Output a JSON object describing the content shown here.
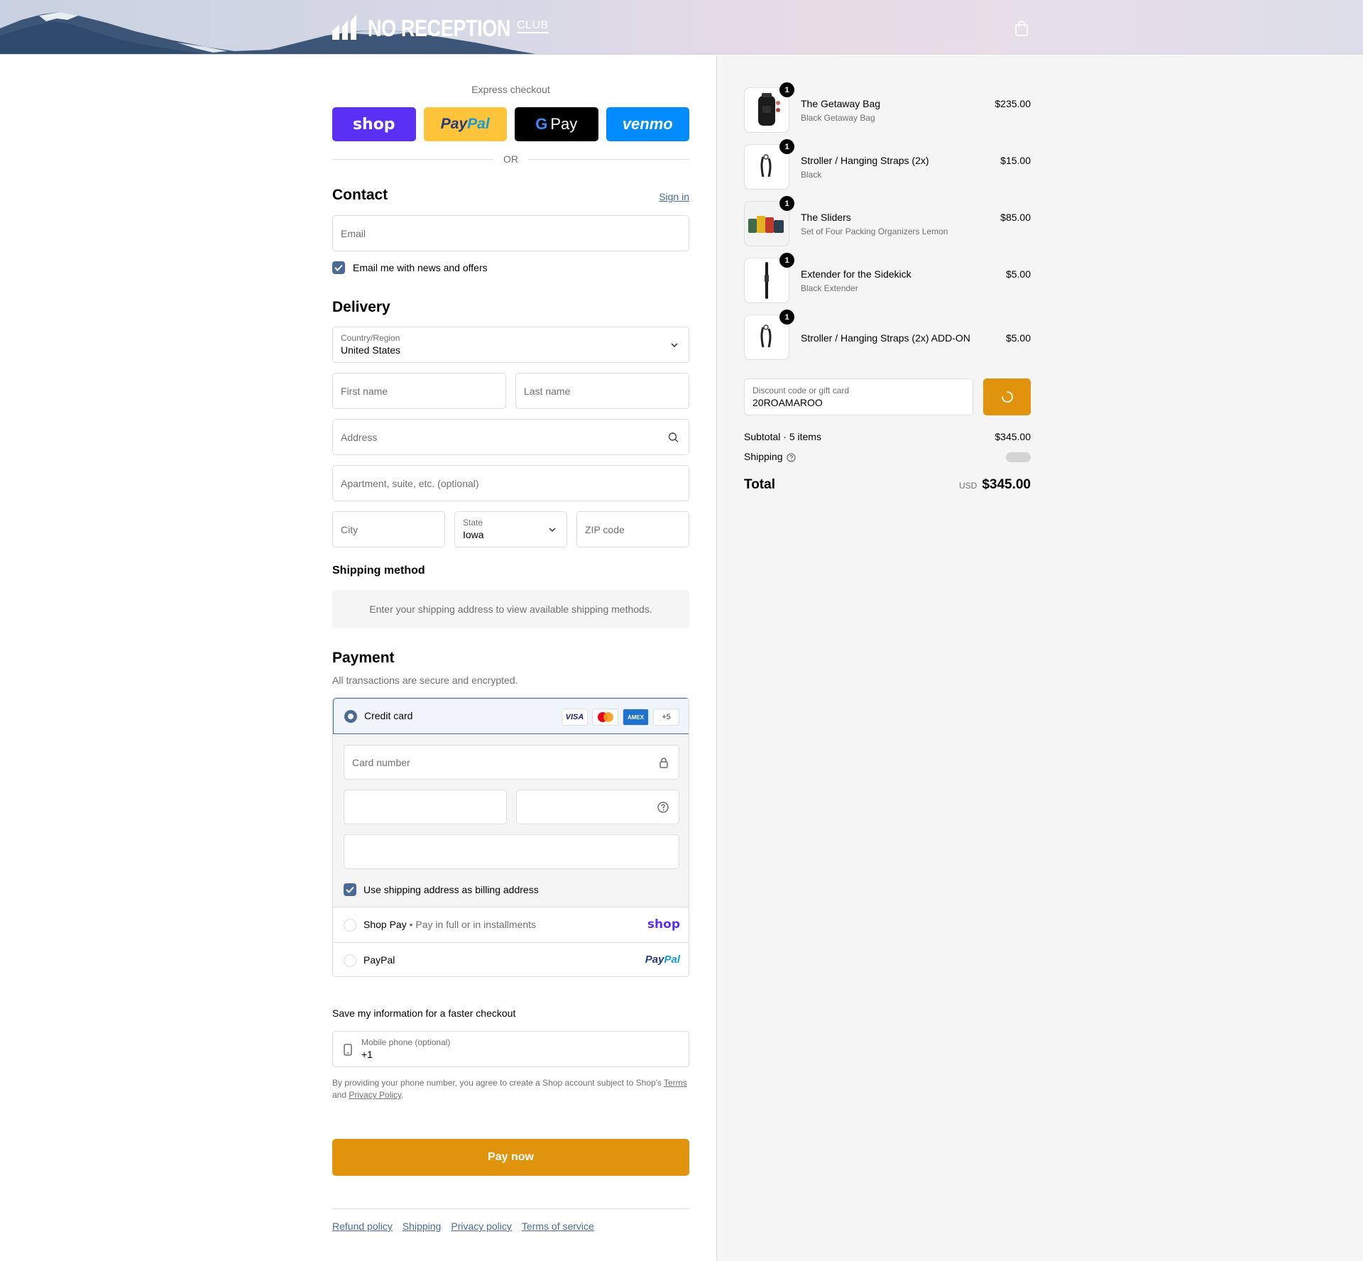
{
  "header": {
    "brand": "NO RECEPTION",
    "brand_suffix": "CLUB",
    "cart_icon": "shopping-bag-icon"
  },
  "express": {
    "label": "Express checkout",
    "buttons": [
      {
        "name": "Shop Pay",
        "text": "shop",
        "color": "#5a31f4"
      },
      {
        "name": "PayPal",
        "text": "PayPal",
        "color": "#ffc439"
      },
      {
        "name": "Google Pay",
        "text": "Pay",
        "color": "#000000"
      },
      {
        "name": "Venmo",
        "text": "venmo",
        "color": "#008cff"
      }
    ],
    "or": "OR"
  },
  "contact": {
    "title": "Contact",
    "sign_in": "Sign in",
    "email_placeholder": "Email",
    "newsletter_label": "Email me with news and offers",
    "newsletter_checked": true
  },
  "delivery": {
    "title": "Delivery",
    "country_label": "Country/Region",
    "country_value": "United States",
    "first_name_placeholder": "First name",
    "last_name_placeholder": "Last name",
    "address_placeholder": "Address",
    "apartment_placeholder": "Apartment, suite, etc. (optional)",
    "city_placeholder": "City",
    "state_label": "State",
    "state_value": "Iowa",
    "zip_placeholder": "ZIP code"
  },
  "shipping_method": {
    "title": "Shipping method",
    "note": "Enter your shipping address to view available shipping methods."
  },
  "payment": {
    "title": "Payment",
    "subtitle": "All transactions are secure and encrypted.",
    "credit_card_label": "Credit card",
    "card_brands": [
      "VISA",
      "Mastercard",
      "AMEX",
      "+5"
    ],
    "card_number_placeholder": "Card number",
    "billing_same_label": "Use shipping address as billing address",
    "billing_same_checked": true,
    "shop_pay_label": "Shop Pay",
    "shop_pay_note": "Pay in full or in installments",
    "shop_pay_logo": "shop",
    "paypal_label": "PayPal",
    "paypal_logo": "PayPal"
  },
  "save_info": {
    "title": "Save my information for a faster checkout",
    "phone_label": "Mobile phone (optional)",
    "phone_value": "+1",
    "legal_prefix": "By providing your phone number, you agree to create a Shop account subject to Shop's",
    "terms_link": "Terms",
    "legal_and": "and",
    "privacy_link": "Privacy Policy",
    "legal_end": "."
  },
  "pay_now": "Pay now",
  "footer_links": [
    "Refund policy",
    "Shipping",
    "Privacy policy",
    "Terms of service"
  ],
  "order": {
    "items": [
      {
        "name": "The Getaway Bag",
        "variant": "Black Getaway Bag",
        "price": "$235.00",
        "qty": "1"
      },
      {
        "name": "Stroller / Hanging Straps (2x)",
        "variant": "Black",
        "price": "$15.00",
        "qty": "1"
      },
      {
        "name": "The Sliders",
        "variant": "Set of Four Packing Organizers Lemon",
        "price": "$85.00",
        "qty": "1"
      },
      {
        "name": "Extender for the Sidekick",
        "variant": "Black Extender",
        "price": "$5.00",
        "qty": "1"
      },
      {
        "name": "Stroller / Hanging Straps (2x) ADD-ON",
        "variant": "",
        "price": "$5.00",
        "qty": "1"
      }
    ],
    "discount_label": "Discount code or gift card",
    "discount_value": "20ROAMAROO",
    "subtotal_label": "Subtotal · 5 items",
    "subtotal_value": "$345.00",
    "shipping_label": "Shipping",
    "total_label": "Total",
    "currency": "USD",
    "total_value": "$345.00"
  }
}
